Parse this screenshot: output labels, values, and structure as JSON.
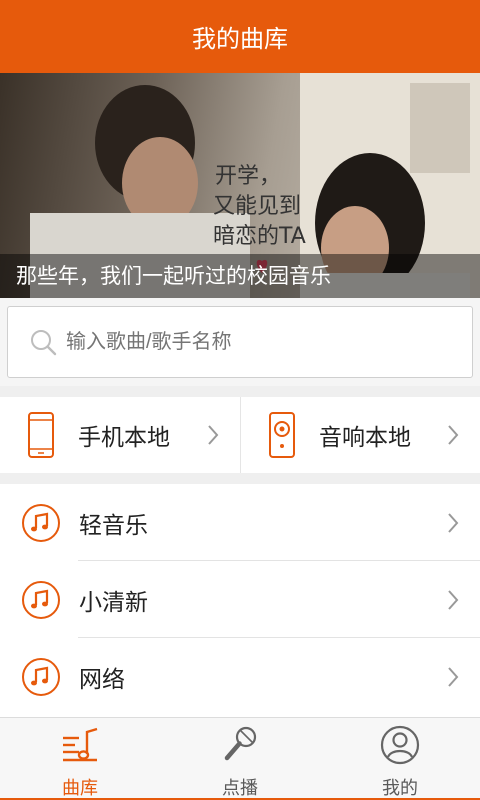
{
  "header": {
    "title": "我的曲库"
  },
  "banner": {
    "caption": "那些年，我们一起听过的校园音乐",
    "handwriting": [
      "开学，",
      "又能见到",
      "暗恋的TA"
    ]
  },
  "search": {
    "placeholder": "输入歌曲/歌手名称"
  },
  "quick": [
    {
      "label": "手机本地",
      "icon": "phone-icon"
    },
    {
      "label": "音响本地",
      "icon": "speaker-icon"
    }
  ],
  "list": [
    {
      "label": "轻音乐",
      "icon": "music-note-icon"
    },
    {
      "label": "小清新",
      "icon": "music-note-icon"
    },
    {
      "label": "网络",
      "icon": "music-note-icon"
    }
  ],
  "tabs": [
    {
      "label": "曲库",
      "icon": "library-icon",
      "active": true
    },
    {
      "label": "点播",
      "icon": "microphone-icon",
      "active": false
    },
    {
      "label": "我的",
      "icon": "user-icon",
      "active": false
    }
  ],
  "colors": {
    "accent": "#e65a0c"
  }
}
